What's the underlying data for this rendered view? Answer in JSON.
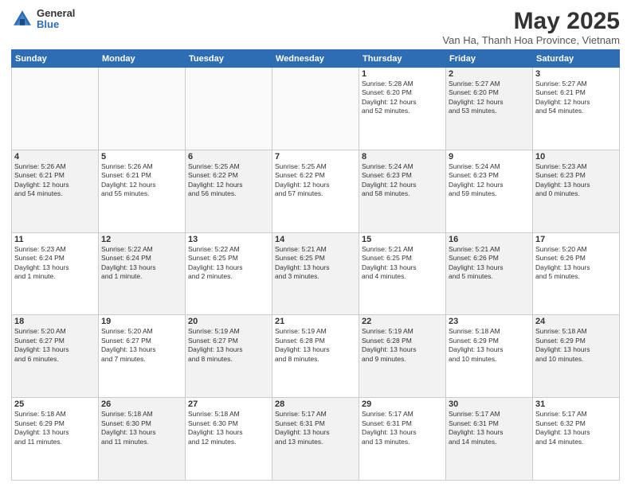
{
  "header": {
    "logo_general": "General",
    "logo_blue": "Blue",
    "month_title": "May 2025",
    "subtitle": "Van Ha, Thanh Hoa Province, Vietnam"
  },
  "days_of_week": [
    "Sunday",
    "Monday",
    "Tuesday",
    "Wednesday",
    "Thursday",
    "Friday",
    "Saturday"
  ],
  "weeks": [
    [
      {
        "day": "",
        "info": "",
        "empty": true
      },
      {
        "day": "",
        "info": "",
        "empty": true
      },
      {
        "day": "",
        "info": "",
        "empty": true
      },
      {
        "day": "",
        "info": "",
        "empty": true
      },
      {
        "day": "1",
        "info": "Sunrise: 5:28 AM\nSunset: 6:20 PM\nDaylight: 12 hours\nand 52 minutes.",
        "empty": false,
        "shaded": false
      },
      {
        "day": "2",
        "info": "Sunrise: 5:27 AM\nSunset: 6:20 PM\nDaylight: 12 hours\nand 53 minutes.",
        "empty": false,
        "shaded": true
      },
      {
        "day": "3",
        "info": "Sunrise: 5:27 AM\nSunset: 6:21 PM\nDaylight: 12 hours\nand 54 minutes.",
        "empty": false,
        "shaded": false
      }
    ],
    [
      {
        "day": "4",
        "info": "Sunrise: 5:26 AM\nSunset: 6:21 PM\nDaylight: 12 hours\nand 54 minutes.",
        "empty": false,
        "shaded": true
      },
      {
        "day": "5",
        "info": "Sunrise: 5:26 AM\nSunset: 6:21 PM\nDaylight: 12 hours\nand 55 minutes.",
        "empty": false,
        "shaded": false
      },
      {
        "day": "6",
        "info": "Sunrise: 5:25 AM\nSunset: 6:22 PM\nDaylight: 12 hours\nand 56 minutes.",
        "empty": false,
        "shaded": true
      },
      {
        "day": "7",
        "info": "Sunrise: 5:25 AM\nSunset: 6:22 PM\nDaylight: 12 hours\nand 57 minutes.",
        "empty": false,
        "shaded": false
      },
      {
        "day": "8",
        "info": "Sunrise: 5:24 AM\nSunset: 6:23 PM\nDaylight: 12 hours\nand 58 minutes.",
        "empty": false,
        "shaded": true
      },
      {
        "day": "9",
        "info": "Sunrise: 5:24 AM\nSunset: 6:23 PM\nDaylight: 12 hours\nand 59 minutes.",
        "empty": false,
        "shaded": false
      },
      {
        "day": "10",
        "info": "Sunrise: 5:23 AM\nSunset: 6:23 PM\nDaylight: 13 hours\nand 0 minutes.",
        "empty": false,
        "shaded": true
      }
    ],
    [
      {
        "day": "11",
        "info": "Sunrise: 5:23 AM\nSunset: 6:24 PM\nDaylight: 13 hours\nand 1 minute.",
        "empty": false,
        "shaded": false
      },
      {
        "day": "12",
        "info": "Sunrise: 5:22 AM\nSunset: 6:24 PM\nDaylight: 13 hours\nand 1 minute.",
        "empty": false,
        "shaded": true
      },
      {
        "day": "13",
        "info": "Sunrise: 5:22 AM\nSunset: 6:25 PM\nDaylight: 13 hours\nand 2 minutes.",
        "empty": false,
        "shaded": false
      },
      {
        "day": "14",
        "info": "Sunrise: 5:21 AM\nSunset: 6:25 PM\nDaylight: 13 hours\nand 3 minutes.",
        "empty": false,
        "shaded": true
      },
      {
        "day": "15",
        "info": "Sunrise: 5:21 AM\nSunset: 6:25 PM\nDaylight: 13 hours\nand 4 minutes.",
        "empty": false,
        "shaded": false
      },
      {
        "day": "16",
        "info": "Sunrise: 5:21 AM\nSunset: 6:26 PM\nDaylight: 13 hours\nand 5 minutes.",
        "empty": false,
        "shaded": true
      },
      {
        "day": "17",
        "info": "Sunrise: 5:20 AM\nSunset: 6:26 PM\nDaylight: 13 hours\nand 5 minutes.",
        "empty": false,
        "shaded": false
      }
    ],
    [
      {
        "day": "18",
        "info": "Sunrise: 5:20 AM\nSunset: 6:27 PM\nDaylight: 13 hours\nand 6 minutes.",
        "empty": false,
        "shaded": true
      },
      {
        "day": "19",
        "info": "Sunrise: 5:20 AM\nSunset: 6:27 PM\nDaylight: 13 hours\nand 7 minutes.",
        "empty": false,
        "shaded": false
      },
      {
        "day": "20",
        "info": "Sunrise: 5:19 AM\nSunset: 6:27 PM\nDaylight: 13 hours\nand 8 minutes.",
        "empty": false,
        "shaded": true
      },
      {
        "day": "21",
        "info": "Sunrise: 5:19 AM\nSunset: 6:28 PM\nDaylight: 13 hours\nand 8 minutes.",
        "empty": false,
        "shaded": false
      },
      {
        "day": "22",
        "info": "Sunrise: 5:19 AM\nSunset: 6:28 PM\nDaylight: 13 hours\nand 9 minutes.",
        "empty": false,
        "shaded": true
      },
      {
        "day": "23",
        "info": "Sunrise: 5:18 AM\nSunset: 6:29 PM\nDaylight: 13 hours\nand 10 minutes.",
        "empty": false,
        "shaded": false
      },
      {
        "day": "24",
        "info": "Sunrise: 5:18 AM\nSunset: 6:29 PM\nDaylight: 13 hours\nand 10 minutes.",
        "empty": false,
        "shaded": true
      }
    ],
    [
      {
        "day": "25",
        "info": "Sunrise: 5:18 AM\nSunset: 6:29 PM\nDaylight: 13 hours\nand 11 minutes.",
        "empty": false,
        "shaded": false
      },
      {
        "day": "26",
        "info": "Sunrise: 5:18 AM\nSunset: 6:30 PM\nDaylight: 13 hours\nand 11 minutes.",
        "empty": false,
        "shaded": true
      },
      {
        "day": "27",
        "info": "Sunrise: 5:18 AM\nSunset: 6:30 PM\nDaylight: 13 hours\nand 12 minutes.",
        "empty": false,
        "shaded": false
      },
      {
        "day": "28",
        "info": "Sunrise: 5:17 AM\nSunset: 6:31 PM\nDaylight: 13 hours\nand 13 minutes.",
        "empty": false,
        "shaded": true
      },
      {
        "day": "29",
        "info": "Sunrise: 5:17 AM\nSunset: 6:31 PM\nDaylight: 13 hours\nand 13 minutes.",
        "empty": false,
        "shaded": false
      },
      {
        "day": "30",
        "info": "Sunrise: 5:17 AM\nSunset: 6:31 PM\nDaylight: 13 hours\nand 14 minutes.",
        "empty": false,
        "shaded": true
      },
      {
        "day": "31",
        "info": "Sunrise: 5:17 AM\nSunset: 6:32 PM\nDaylight: 13 hours\nand 14 minutes.",
        "empty": false,
        "shaded": false
      }
    ]
  ]
}
